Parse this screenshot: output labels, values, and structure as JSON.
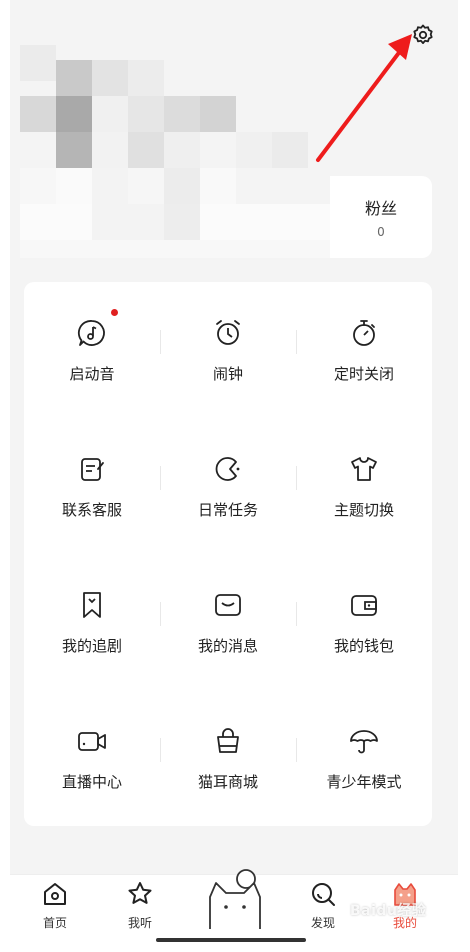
{
  "profile": {
    "fans_label": "粉丝",
    "fans_count": "0"
  },
  "menu": {
    "items": [
      {
        "label": "启动音",
        "icon": "music-note-bubble-icon"
      },
      {
        "label": "闹钟",
        "icon": "alarm-clock-icon"
      },
      {
        "label": "定时关闭",
        "icon": "timer-icon"
      },
      {
        "label": "联系客服",
        "icon": "edit-note-icon"
      },
      {
        "label": "日常任务",
        "icon": "moon-task-icon"
      },
      {
        "label": "主题切换",
        "icon": "tshirt-icon"
      },
      {
        "label": "我的追剧",
        "icon": "bookmark-icon"
      },
      {
        "label": "我的消息",
        "icon": "message-icon"
      },
      {
        "label": "我的钱包",
        "icon": "wallet-icon"
      },
      {
        "label": "直播中心",
        "icon": "video-camera-icon"
      },
      {
        "label": "猫耳商城",
        "icon": "shopping-bag-icon"
      },
      {
        "label": "青少年模式",
        "icon": "umbrella-icon"
      }
    ]
  },
  "tabbar": {
    "tabs": [
      {
        "label": "首页",
        "icon": "home-icon"
      },
      {
        "label": "我听",
        "icon": "star-icon"
      },
      {
        "label": "发现",
        "icon": "discover-icon"
      },
      {
        "label": "我的",
        "icon": "cat-profile-icon"
      }
    ],
    "active_tab": "我的"
  },
  "watermark": "Baidu经验",
  "colors": {
    "accent": "#e84b3c",
    "notification_dot": "#e02020",
    "arrow": "#ee1c1c",
    "background": "#f4f4f4"
  }
}
